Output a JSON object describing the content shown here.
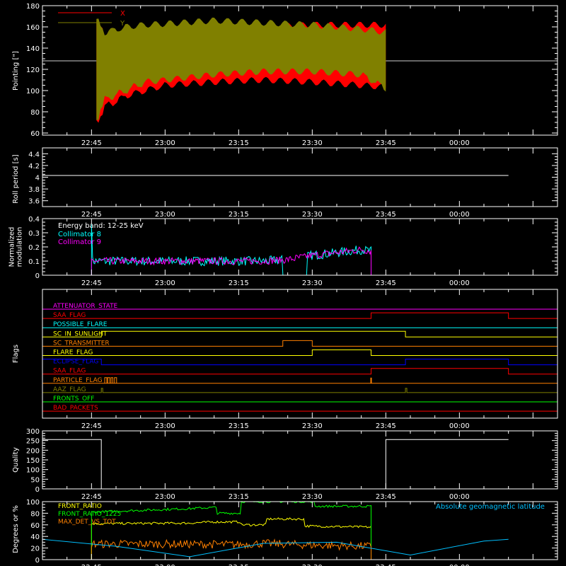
{
  "chart_data": [
    {
      "id": "pointing",
      "type": "line",
      "ylabel": "Pointing [\"]",
      "ylim": [
        58,
        180
      ],
      "yticks": [
        60,
        80,
        100,
        120,
        140,
        160,
        180
      ],
      "xticks": [
        "22:45",
        "23:00",
        "23:15",
        "23:30",
        "23:45",
        "00:00"
      ],
      "legend_position": "top-left",
      "reference_line": 128,
      "series": [
        {
          "name": "X",
          "color": "#ff0000",
          "band_x": [
            "22:46",
            "22:48",
            "22:52",
            "22:56",
            "23:00",
            "23:10",
            "23:20",
            "23:30",
            "23:40",
            "23:45"
          ],
          "upper": [
            165,
            150,
            155,
            158,
            160,
            162,
            160,
            162,
            162,
            162
          ],
          "lower": [
            72,
            85,
            95,
            100,
            105,
            108,
            110,
            108,
            105,
            103
          ]
        },
        {
          "name": "Y",
          "color": "#808000",
          "band_x": [
            "22:46",
            "22:48",
            "22:52",
            "22:56",
            "23:00",
            "23:10",
            "23:20",
            "23:30",
            "23:40",
            "23:45"
          ],
          "upper": [
            165,
            155,
            160,
            162,
            163,
            166,
            164,
            162,
            158,
            155
          ],
          "lower": [
            75,
            92,
            100,
            108,
            110,
            115,
            118,
            118,
            115,
            102
          ]
        }
      ]
    },
    {
      "id": "roll",
      "type": "line",
      "ylabel": "Roll period [s]",
      "ylim": [
        3.5,
        4.5
      ],
      "yticks": [
        3.6,
        3.8,
        4.0,
        4.2,
        4.4
      ],
      "xticks": [
        "22:45",
        "23:00",
        "23:15",
        "23:30",
        "23:45",
        "00:00"
      ],
      "series": [
        {
          "name": "",
          "color": "#ffffff",
          "x": [
            "22:35",
            "00:10"
          ],
          "values": [
            4.03,
            4.03
          ]
        }
      ]
    },
    {
      "id": "modulation",
      "type": "line",
      "ylabel_lines": [
        "Normalized",
        "modulation"
      ],
      "ylim": [
        0,
        0.4
      ],
      "yticks": [
        0.0,
        0.1,
        0.2,
        0.3,
        0.4
      ],
      "xticks": [
        "22:45",
        "23:00",
        "23:15",
        "23:30",
        "23:45",
        "00:00"
      ],
      "annotations": [
        "Energy band: 12-25 keV"
      ],
      "series": [
        {
          "name": "Collimator 8",
          "color": "#00ffff"
        },
        {
          "name": "Collimator 9",
          "color": "#ff00ff"
        }
      ],
      "profile_x": [
        "22:45",
        "22:50",
        "23:00",
        "23:10",
        "23:20",
        "23:25",
        "23:30",
        "23:35",
        "23:40",
        "23:42"
      ],
      "profile_y": [
        0.1,
        0.1,
        0.1,
        0.1,
        0.1,
        0.11,
        0.14,
        0.16,
        0.18,
        0.17
      ],
      "active_range": [
        "22:45",
        "23:42"
      ]
    },
    {
      "id": "flags",
      "type": "line",
      "ylabel": "Flags",
      "xticks": [
        "22:45",
        "23:00",
        "23:15",
        "23:30",
        "23:45",
        "00:00"
      ],
      "series": [
        {
          "name": "ATTENUATOR_STATE",
          "color": "#ff00ff",
          "steps": []
        },
        {
          "name": "SAA_FLAG",
          "color": "#ff0000",
          "steps": [
            [
              "23:42",
              "00:10"
            ]
          ]
        },
        {
          "name": "POSSIBLE_FLARE",
          "color": "#00ffff",
          "steps": []
        },
        {
          "name": "SC_IN_SUNLIGHT",
          "color": "#ffff00",
          "steps": [
            [
              "22:47",
              "23:49"
            ]
          ]
        },
        {
          "name": "SC_TRANSMITTER",
          "color": "#ff8000",
          "steps": [
            [
              "23:24",
              "23:30"
            ]
          ]
        },
        {
          "name": "FLARE_FLAG",
          "color": "#ffff00",
          "steps": [
            [
              "23:30",
              "23:42"
            ]
          ]
        },
        {
          "name": "ECLIPSE_FLAG",
          "color": "#0000ff",
          "steps": [
            [
              "22:35",
              "22:47"
            ],
            [
              "23:49",
              "00:10"
            ]
          ]
        },
        {
          "name": "SAA_FLAG",
          "color": "#ff0000",
          "steps": [
            [
              "23:42",
              "00:10"
            ]
          ]
        },
        {
          "name": "PARTICLE_FLAG",
          "color": "#ff8000",
          "steps": []
        },
        {
          "name": "AAZ_FLAG",
          "color": "#808000",
          "steps": [
            [
              "22:47",
              "22:47"
            ],
            [
              "23:49",
              "23:49"
            ]
          ]
        },
        {
          "name": "FRONTS_OFF",
          "color": "#00ff00",
          "steps": []
        },
        {
          "name": "BAD_PACKETS",
          "color": "#ff0000",
          "steps": []
        }
      ]
    },
    {
      "id": "quality",
      "type": "line",
      "ylabel": "Quality",
      "ylim": [
        0,
        300
      ],
      "yticks": [
        0,
        50,
        100,
        150,
        200,
        250,
        300
      ],
      "xticks": [
        "22:45",
        "23:00",
        "23:15",
        "23:30",
        "23:45",
        "00:00"
      ],
      "series": [
        {
          "name": "",
          "color": "#ffffff",
          "segments": [
            [
              [
                "22:35",
                255
              ],
              [
                "22:47",
                255
              ],
              [
                "22:47",
                0
              ]
            ],
            [
              [
                "23:45",
                0
              ],
              [
                "23:45",
                255
              ],
              [
                "00:10",
                255
              ]
            ]
          ]
        }
      ]
    },
    {
      "id": "ratios",
      "type": "line",
      "ylabel": "Degrees or %",
      "ylim": [
        0,
        100
      ],
      "yticks": [
        0,
        20,
        40,
        60,
        80,
        100
      ],
      "xticks": [
        "22:45",
        "23:00",
        "23:15",
        "23:30",
        "23:45",
        "00:00"
      ],
      "series": [
        {
          "name": "FRONT_RATIO",
          "color": "#ffff00",
          "x": [
            "22:45",
            "23:05",
            "23:10",
            "23:10",
            "23:15",
            "23:15",
            "23:20",
            "23:20",
            "23:28",
            "23:28",
            "23:42"
          ],
          "values": [
            62,
            63,
            65,
            65,
            65,
            60,
            60,
            70,
            70,
            58,
            56
          ]
        },
        {
          "name": "FRONT_RATIO_1225",
          "color": "#00ff00",
          "x": [
            "22:45",
            "23:05",
            "23:10",
            "23:10",
            "23:15",
            "23:15",
            "23:20",
            "23:20",
            "23:30",
            "23:30",
            "23:42"
          ],
          "values": [
            82,
            88,
            90,
            80,
            80,
            100,
            100,
            100,
            100,
            92,
            92
          ]
        },
        {
          "name": "MAX_DET_VS_TOT",
          "color": "#ff8000",
          "x": [
            "22:45",
            "23:00",
            "23:15",
            "23:20",
            "23:30",
            "23:42"
          ],
          "values": [
            27,
            27,
            26,
            28,
            25,
            23
          ]
        },
        {
          "name": "Absolute geomagnetic latitude",
          "color": "#00c0ff",
          "x": [
            "22:35",
            "22:50",
            "23:05",
            "23:20",
            "23:35",
            "23:50",
            "00:05",
            "00:10"
          ],
          "values": [
            35,
            23,
            5,
            28,
            30,
            8,
            32,
            35
          ]
        }
      ]
    }
  ]
}
